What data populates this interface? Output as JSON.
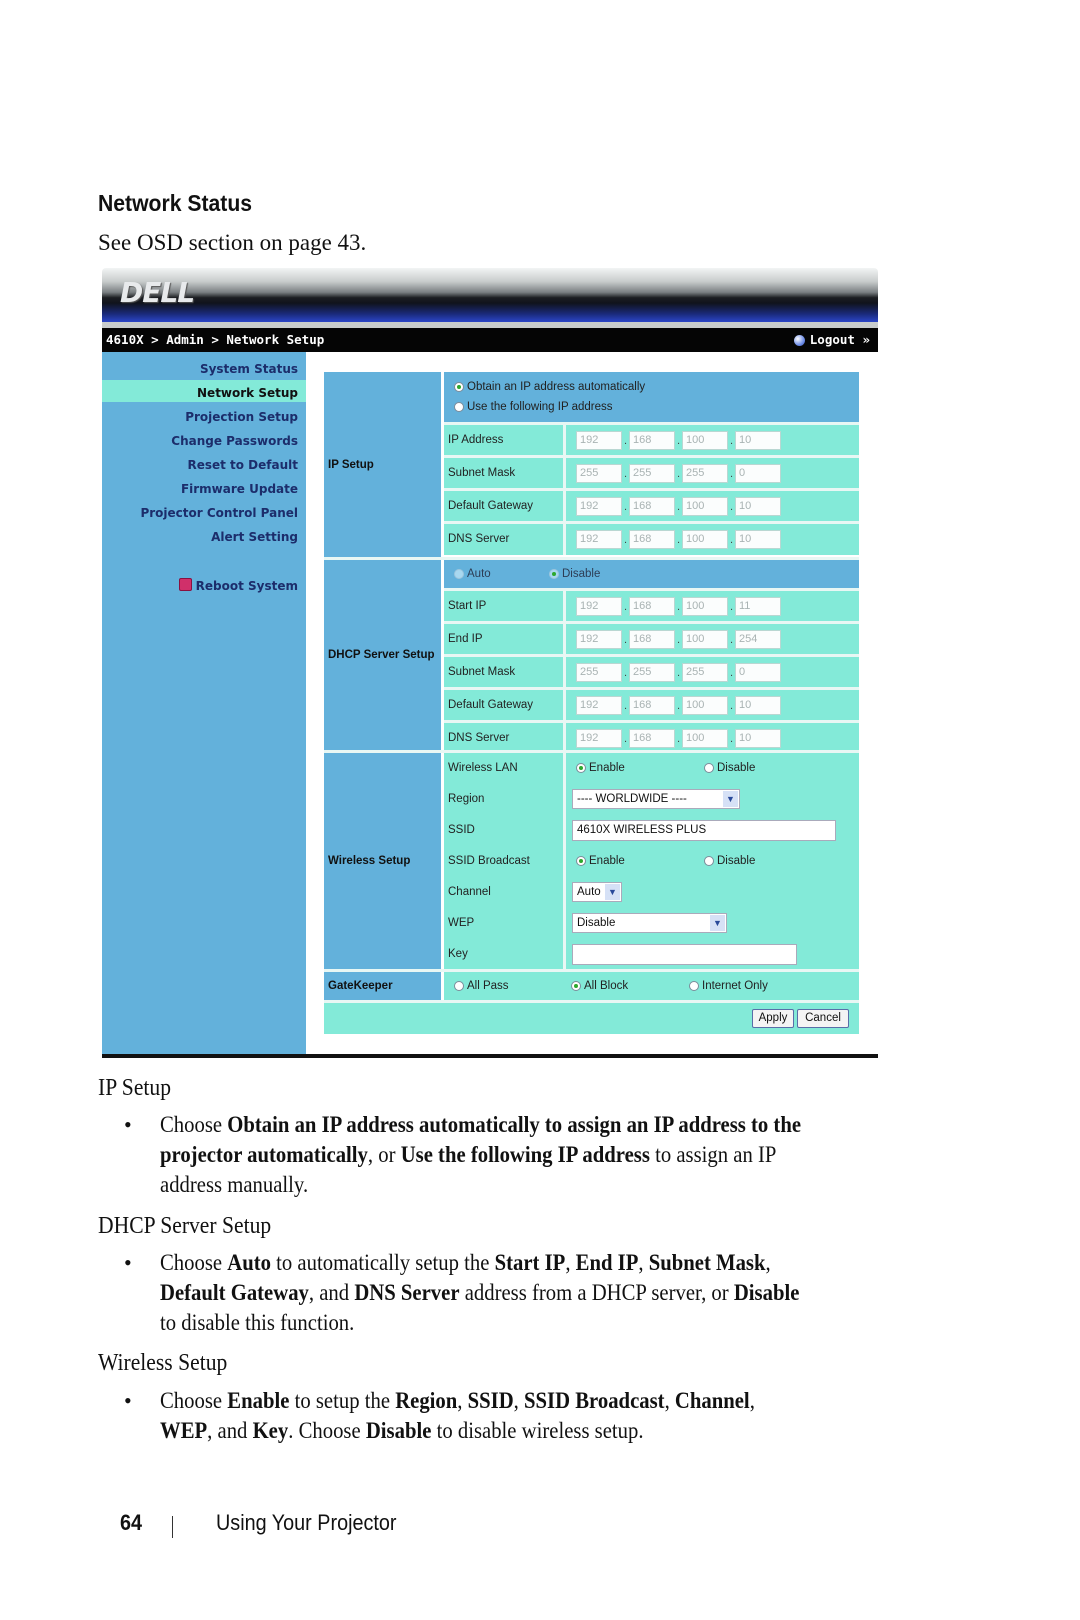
{
  "page": {
    "section_heading": "Network Status",
    "intro": "See OSD section on page 43.",
    "footer": {
      "page_number": "64",
      "chapter": "Using Your Projector"
    }
  },
  "app": {
    "logo": "DELL",
    "breadcrumb": "4610X > Admin > Network Setup",
    "logout_label": "Logout »",
    "colors": {
      "sidebar": "#63b1db",
      "row": "#83ead8",
      "active_nav": "#83ead8",
      "breadcrumb_bar": "#050505"
    }
  },
  "sidebar": {
    "items": [
      {
        "label": "System Status",
        "active": false
      },
      {
        "label": "Network Setup",
        "active": true
      },
      {
        "label": "Projection Setup",
        "active": false
      },
      {
        "label": "Change Passwords",
        "active": false
      },
      {
        "label": "Reset to Default",
        "active": false
      },
      {
        "label": "Firmware Update",
        "active": false
      },
      {
        "label": "Projector Control Panel",
        "active": false
      },
      {
        "label": "Alert Setting",
        "active": false
      }
    ],
    "reboot_label": "Reboot System"
  },
  "ip_setup": {
    "group_label": "IP Setup",
    "mode_options": [
      {
        "label": "Obtain an IP address automatically",
        "selected": true
      },
      {
        "label": "Use the following IP address",
        "selected": false
      }
    ],
    "fields": [
      {
        "label": "IP Address",
        "octets": [
          "192",
          "168",
          "100",
          "10"
        ]
      },
      {
        "label": "Subnet Mask",
        "octets": [
          "255",
          "255",
          "255",
          "0"
        ]
      },
      {
        "label": "Default Gateway",
        "octets": [
          "192",
          "168",
          "100",
          "10"
        ]
      },
      {
        "label": "DNS Server",
        "octets": [
          "192",
          "168",
          "100",
          "10"
        ]
      }
    ]
  },
  "dhcp": {
    "group_label": "DHCP Server Setup",
    "mode_options": [
      {
        "label": "Auto",
        "selected": false
      },
      {
        "label": "Disable",
        "selected": true
      }
    ],
    "fields": [
      {
        "label": "Start IP",
        "octets": [
          "192",
          "168",
          "100",
          "11"
        ]
      },
      {
        "label": "End IP",
        "octets": [
          "192",
          "168",
          "100",
          "254"
        ]
      },
      {
        "label": "Subnet Mask",
        "octets": [
          "255",
          "255",
          "255",
          "0"
        ]
      },
      {
        "label": "Default Gateway",
        "octets": [
          "192",
          "168",
          "100",
          "10"
        ]
      },
      {
        "label": "DNS Server",
        "octets": [
          "192",
          "168",
          "100",
          "10"
        ]
      }
    ]
  },
  "wireless": {
    "group_label": "Wireless Setup",
    "wireless_lan": {
      "label": "Wireless LAN",
      "options": [
        {
          "label": "Enable",
          "selected": true
        },
        {
          "label": "Disable",
          "selected": false
        }
      ]
    },
    "region": {
      "label": "Region",
      "value": "---- WORLDWIDE ----"
    },
    "ssid": {
      "label": "SSID",
      "value": "4610X WIRELESS PLUS"
    },
    "ssid_broadcast": {
      "label": "SSID Broadcast",
      "options": [
        {
          "label": "Enable",
          "selected": true
        },
        {
          "label": "Disable",
          "selected": false
        }
      ]
    },
    "channel": {
      "label": "Channel",
      "value": "Auto"
    },
    "wep": {
      "label": "WEP",
      "value": "Disable"
    },
    "key": {
      "label": "Key",
      "value": ""
    }
  },
  "gatekeeper": {
    "group_label": "GateKeeper",
    "options": [
      {
        "label": "All Pass",
        "selected": false
      },
      {
        "label": "All Block",
        "selected": true
      },
      {
        "label": "Internet Only",
        "selected": false
      }
    ]
  },
  "buttons": {
    "apply": "Apply",
    "cancel": "Cancel"
  },
  "body": {
    "ip_heading": "IP Setup",
    "ip_line1": [
      "Choose ",
      "Obtain an IP address automatically to assign an IP address to the"
    ],
    "ip_line2": [
      "projector automatically",
      ", or ",
      "Use the following IP address",
      " to assign an IP"
    ],
    "ip_line3": "address manually.",
    "dhcp_heading": "DHCP Server Setup",
    "dhcp_line1": [
      "Choose ",
      "Auto",
      " to automatically setup the ",
      "Start IP",
      ", ",
      "End IP",
      ", ",
      "Subnet Mask",
      ","
    ],
    "dhcp_line2": [
      "Default Gateway",
      ", and ",
      "DNS Server",
      " address from a DHCP server, or ",
      "Disable"
    ],
    "dhcp_line3": "to disable this function.",
    "wireless_heading": "Wireless Setup",
    "wl_line1": [
      "Choose ",
      "Enable",
      " to setup the ",
      "Region",
      ", ",
      "SSID",
      ", ",
      "SSID Broadcast",
      ", ",
      "Channel",
      ","
    ],
    "wl_line2": [
      "WEP",
      ", and ",
      "Key",
      ". Choose ",
      "Disable",
      " to disable wireless setup."
    ],
    "bullet": "•"
  }
}
